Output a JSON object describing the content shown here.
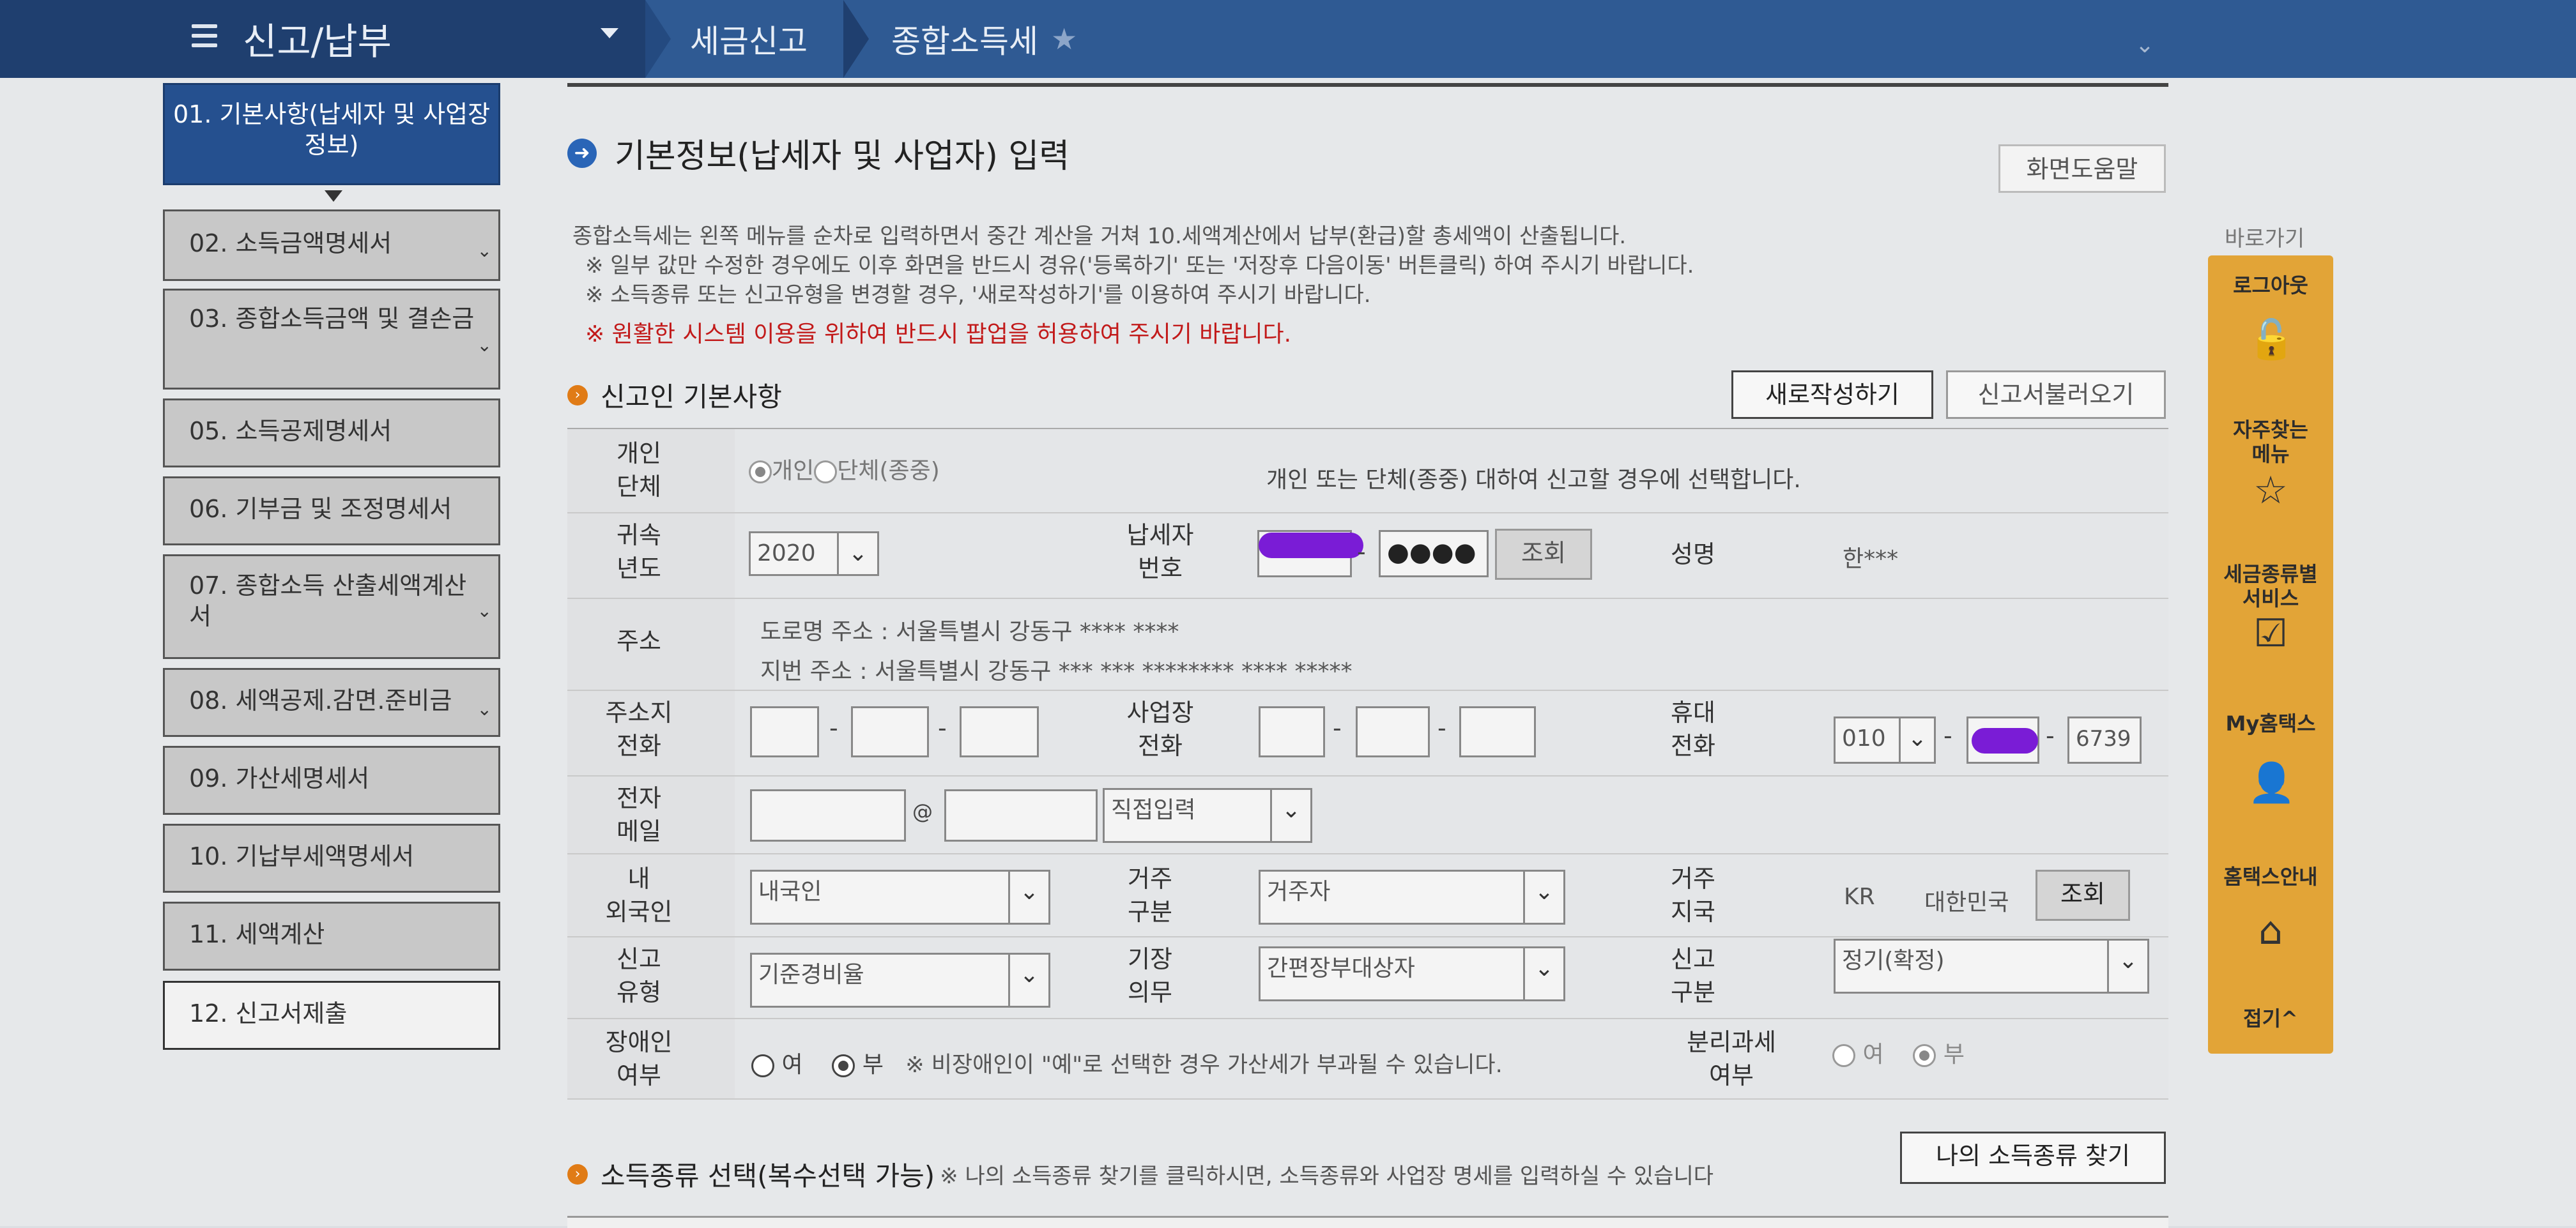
{
  "header": {
    "title": "신고/납부",
    "breadcrumbs": [
      "세금신고",
      "종합소득세"
    ]
  },
  "sidebar": {
    "items": [
      {
        "label": "01. 기본사항(납세자 및 사업장정보)"
      },
      {
        "label": "02. 소득금액명세서"
      },
      {
        "label": "03. 종합소득금액 및 결손금"
      },
      {
        "label": "05. 소득공제명세서"
      },
      {
        "label": "06. 기부금 및 조정명세서"
      },
      {
        "label": "07. 종합소득 산출세액계산서"
      },
      {
        "label": "08. 세액공제.감면.준비금"
      },
      {
        "label": "09. 가산세명세서"
      },
      {
        "label": "10. 기납부세액명세서"
      },
      {
        "label": "11. 세액계산"
      },
      {
        "label": "12. 신고서제출"
      }
    ]
  },
  "main": {
    "title": "기본정보(납세자 및 사업자) 입력",
    "help_button": "화면도움말",
    "notes": [
      "종합소득세는 왼쪽 메뉴를 순차로 입력하면서 중간 계산을 거쳐 10.세액계산에서 납부(환급)할 총세액이 산출됩니다.",
      "※ 일부 값만 수정한 경우에도 이후 화면을 반드시 경유('등록하기' 또는 '저장후 다음이동' 버튼클릭) 하여 주시기 바랍니다.",
      "※ 소득종류 또는 신고유형을 변경할 경우, '새로작성하기'를 이용하여 주시기 바랍니다."
    ],
    "warning": "※ 원활한 시스템 이용을 위하여 반드시 팝업을 허용하여 주시기 바랍니다.",
    "section_title": "신고인 기본사항",
    "new_button": "새로작성하기",
    "load_button": "신고서불러오기"
  },
  "form": {
    "type_label": "개인\n단체",
    "type_options": [
      "개인",
      "단체(종중)"
    ],
    "type_hint": "개인 또는 단체(종중) 대하여 신고할 경우에 선택합니다.",
    "year_label": "귀속\n년도",
    "year_value": "2020",
    "taxpayer_no_label": "납세자\n번호",
    "taxpayer_no_masked": "●●●●",
    "lookup_label": "조회",
    "name_label": "성명",
    "name_value": "한***",
    "address_label": "주소",
    "road_address": "도로명 주소 :  서울특별시 강동구 **** ****",
    "lot_address": "지번 주소 :  서울특별시 강동구 *** *** ******** **** *****",
    "home_phone_label": "주소지\n전화",
    "biz_phone_label": "사업장\n전화",
    "mobile_label": "휴대\n전화",
    "mobile_prefix": "010",
    "mobile_last": "6739",
    "email_label": "전자\n메일",
    "email_at": "@",
    "email_domain_select": "직접입력",
    "nationality_label": "내\n외국인",
    "nationality_value": "내국인",
    "residency_label": "거주\n구분",
    "residency_value": "거주자",
    "country_label": "거주\n지국",
    "country_code": "KR",
    "country_name": "대한민국",
    "country_lookup": "조회",
    "report_type_label": "신고\n유형",
    "report_type_value": "기준경비율",
    "bookkeeping_label": "기장\n의무",
    "bookkeeping_value": "간편장부대상자",
    "report_class_label": "신고\n구분",
    "report_class_value": "정기(확정)",
    "disabled_label": "장애인\n여부",
    "yes": "여",
    "no": "부",
    "disabled_note": "※ 비장애인이 \"예\"로 선택한 경우 가산세가 부과될 수 있습니다.",
    "separate_tax_label": "분리과세\n여부"
  },
  "income_section": {
    "title": "소득종류 선택(복수선택 가능)",
    "note": "※ 나의 소득종류 찾기를 클릭하시면, 소득종류와 사업장 명세를 입력하실 수 있습니다",
    "find_button": "나의 소득종류 찾기"
  },
  "quickbar": {
    "title": "바로가기",
    "items": [
      {
        "label": "로그아웃",
        "icon": "unlock-icon"
      },
      {
        "label": "자주찾는\n메뉴",
        "icon": "star-icon"
      },
      {
        "label": "세금종류별\n서비스",
        "icon": "checkbox-icon"
      },
      {
        "label": "My홈택스",
        "icon": "user-icon"
      },
      {
        "label": "홈택스안내",
        "icon": "home-icon"
      },
      {
        "label": "접기^",
        "icon": ""
      }
    ]
  },
  "colors": {
    "header_bg": "#1f3f6f",
    "active_nav": "#25508f",
    "accent_orange": "#e2a437",
    "warning_red": "#c21a1a"
  }
}
